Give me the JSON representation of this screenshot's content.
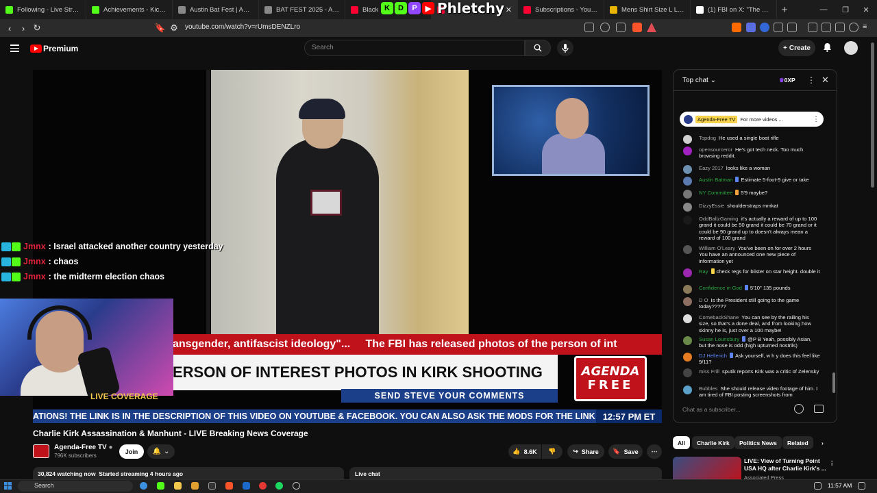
{
  "browser": {
    "tabs": [
      {
        "title": "Following - Live Streams o",
        "color": "#53fc18",
        "active": false
      },
      {
        "title": "Achievements - Kick Dashb",
        "color": "#53fc18",
        "active": false
      },
      {
        "title": "Austin Bat Fest | Austin, TX",
        "color": "#888888",
        "active": false
      },
      {
        "title": "BAT FEST 2025 - Austin, Te",
        "color": "#888888",
        "active": false
      },
      {
        "title": "Black",
        "color": "#ff0033",
        "active": false
      },
      {
        "title": "",
        "color": "#ff0033",
        "active": true
      },
      {
        "title": "Subscriptions - YouTube",
        "color": "#ff0033",
        "active": false
      },
      {
        "title": "Mens Shirt Size L Large M",
        "color": "#e8b400",
        "active": false
      },
      {
        "title": "(1) FBI on X: \"The FBI is off",
        "color": "#ffffff",
        "active": false
      }
    ],
    "url": "youtube.com/watch?v=rUmsDENZLro"
  },
  "overlay_logo": {
    "letters": [
      "K",
      "D",
      "P",
      "▶"
    ],
    "word": "Phletchy"
  },
  "youtube": {
    "brand": "Premium",
    "search_placeholder": "Search",
    "create_label": "Create"
  },
  "video": {
    "chyron_red": "ansgender, antifascist ideology\"...     The FBI has released photos of the person of int",
    "chyron_main": "ERSON OF INTEREST PHOTOS IN KIRK SHOOTING",
    "chyron_sub": "SEND STEVE YOUR COMMENTS",
    "logo_line1": "AGENDA",
    "logo_line2": "FREE",
    "ticker": "ATIONS! THE LINK IS IN THE DESCRIPTION OF THIS VIDEO ON YOUTUBE & FACEBOOK. YOU CAN ALSO ASK THE MODS FOR THE LINK",
    "ticker_time": "12:57 PM ET",
    "live_coverage": "LIVE COVERAGE"
  },
  "stream_overlay": {
    "messages": [
      {
        "user": "Jmnx",
        "text": ": Israel attacked another country yesterday"
      },
      {
        "user": "Jmnx",
        "text": ": chaos"
      },
      {
        "user": "Jmnx",
        "text": ": the midterm election chaos"
      }
    ]
  },
  "watch": {
    "title": "Charlie Kirk Assassination & Manhunt - LIVE Breaking News Coverage",
    "channel": "Agenda-Free TV",
    "subscribers": "796K subscribers",
    "join": "Join",
    "likes": "8.6K",
    "share": "Share",
    "save": "Save",
    "watching": "30,824 watching now",
    "started": "Started streaming 4 hours ago",
    "live_chat": "Live chat"
  },
  "chat": {
    "mode": "Top chat",
    "xp": "0XP",
    "pinned": {
      "name": "Agenda-Free TV",
      "text": "For more videos ..."
    },
    "input_placeholder": "Chat as a subscriber...",
    "messages": [
      {
        "author": "Topdog",
        "text": "He used a single boat rifle",
        "style": "",
        "badge": "",
        "avatar": "#cfcfcf"
      },
      {
        "author": "opensourceror",
        "text": "He's got tech neck. Too much browsing reddit.",
        "style": "",
        "badge": "",
        "avatar": "#a020c0"
      },
      {
        "author": "Eazy 2017",
        "text": "looks like a woman",
        "style": "",
        "badge": "",
        "avatar": "#6d8fb0"
      },
      {
        "author": "Austin Batman",
        "text": "Estimate 5-foot-9 give or take",
        "style": "green",
        "badge": "#5e84f1",
        "avatar": "#5a7ab0"
      },
      {
        "author": "NY Committee",
        "text": "5'9 maybe?",
        "style": "green",
        "badge": "#f2a23c",
        "avatar": "#777777"
      },
      {
        "author": "DizzyEssie",
        "text": "shoulderstraps mmkat",
        "style": "",
        "badge": "",
        "avatar": "#888888"
      },
      {
        "author": "OddBallzGaming",
        "text": "it's actually a reward of up to 100 grand it could be 50 grand it could be 70 grand or it could be 90 grand up to doesn't always mean a reward of 100 grand",
        "style": "",
        "badge": "",
        "avatar": "#1a1a1a"
      },
      {
        "author": "William O'Leary",
        "text": "You've been on for over 2 hours You have an announced one new piece of information yet",
        "style": "",
        "badge": "",
        "avatar": "#555555"
      },
      {
        "author": "Ray",
        "text": "check regs for blister on star height. double it",
        "style": "green",
        "badge": "#f6d34a",
        "avatar": "#9c27b0"
      },
      {
        "author": "Confidence in God",
        "text": "5'10\" 135 pounds",
        "style": "green",
        "badge": "#5e84f1",
        "avatar": "#8a7a5a"
      },
      {
        "author": "D O",
        "text": "Is the President still going to the game today?????",
        "style": "",
        "badge": "",
        "avatar": "#8d6e63"
      },
      {
        "author": "ComebackShane",
        "text": "You can see by the railing his size, so that's a done deal, and from looking how skinny he is, just over a 100 maybe!",
        "style": "",
        "badge": "",
        "avatar": "#dddddd"
      },
      {
        "author": "Susan Lounsbury",
        "text": "@P B Yeah, possibly Asian, but the nose is odd (high upturned nostrils)",
        "style": "green",
        "badge": "#5e84f1",
        "avatar": "#6a8a4a"
      },
      {
        "author": "DJ Hellerich",
        "text": "Ask yourself, w h y does this feel like 9/11?",
        "style": "mod",
        "badge": "#5e84f1",
        "avatar": "#e67c22"
      },
      {
        "author": "miss Frill",
        "text": "sputik reports Kirk was a critic of Zelensky",
        "style": "",
        "badge": "",
        "avatar": "#444444"
      },
      {
        "author": "Bubbles",
        "text": "She should release video footage of him. I am tired of FBI posting screenshots from",
        "style": "",
        "badge": "",
        "avatar": "#5aa0c8"
      }
    ]
  },
  "recommendations": {
    "chips": [
      "All",
      "Charlie Kirk",
      "Politics News",
      "Related"
    ],
    "video_title": "LIVE: View of Turning Point USA HQ after Charlie Kirk's ...",
    "video_channel": "Associated Press"
  },
  "taskbar": {
    "search": "Search",
    "time": "11:57 AM"
  }
}
